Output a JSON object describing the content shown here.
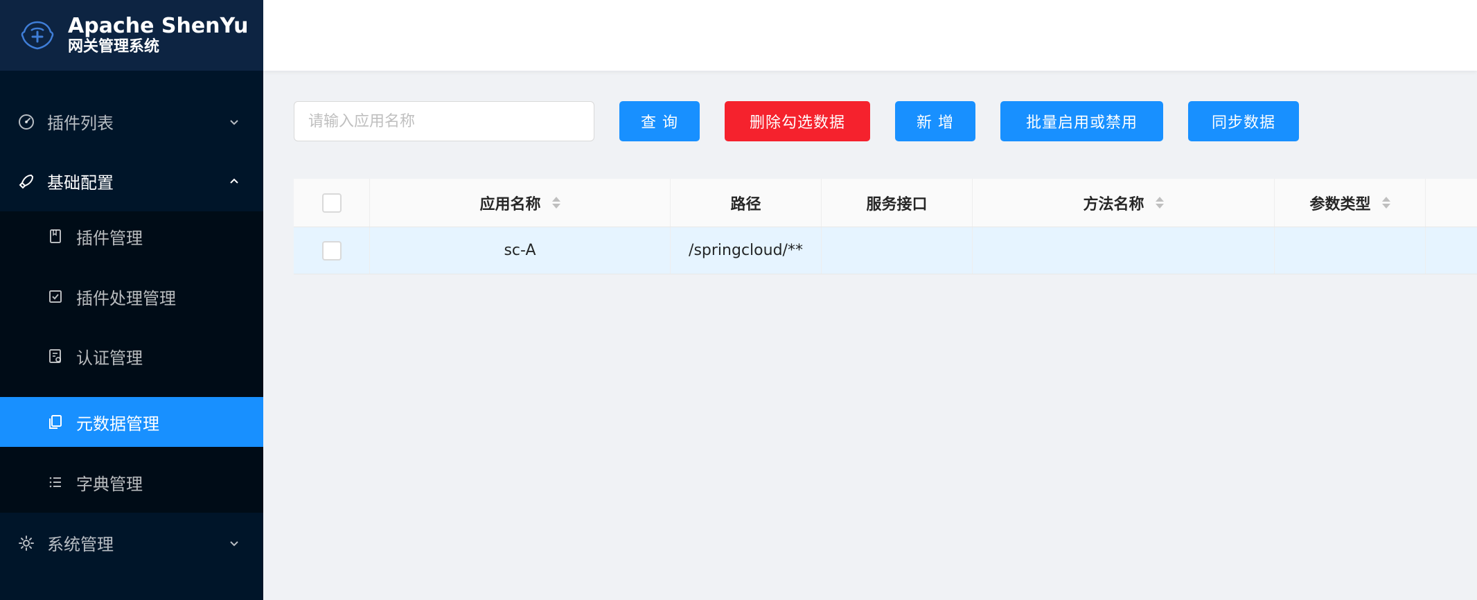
{
  "brand": {
    "title": "Apache ShenYu",
    "subtitle": "网关管理系统"
  },
  "sidebar": {
    "items": [
      {
        "label": "插件列表",
        "icon": "dashboard-icon",
        "expanded": false
      },
      {
        "label": "基础配置",
        "icon": "rocket-icon",
        "expanded": true,
        "children": [
          {
            "label": "插件管理",
            "icon": "book-icon",
            "active": false
          },
          {
            "label": "插件处理管理",
            "icon": "check-square-icon",
            "active": false
          },
          {
            "label": "认证管理",
            "icon": "audit-icon",
            "active": false
          },
          {
            "label": "元数据管理",
            "icon": "snippets-icon",
            "active": true
          },
          {
            "label": "字典管理",
            "icon": "list-icon",
            "active": false
          }
        ]
      },
      {
        "label": "系统管理",
        "icon": "setting-icon",
        "expanded": false
      }
    ]
  },
  "toolbar": {
    "search": {
      "placeholder": "请输入应用名称",
      "value": ""
    },
    "query_label": "查 询",
    "delete_label": "删除勾选数据",
    "add_label": "新 增",
    "batch_label": "批量启用或禁用",
    "sync_label": "同步数据"
  },
  "table": {
    "columns": [
      "应用名称",
      "路径",
      "服务接口",
      "方法名称",
      "参数类型"
    ],
    "rows": [
      {
        "app_name": "sc-A",
        "path": "/springcloud/**",
        "service": "",
        "method": "",
        "param_types": ""
      }
    ]
  },
  "colors": {
    "sidebar_bg": "#001529",
    "submenu_bg": "#000c17",
    "primary": "#1890ff",
    "danger": "#f5222d"
  }
}
